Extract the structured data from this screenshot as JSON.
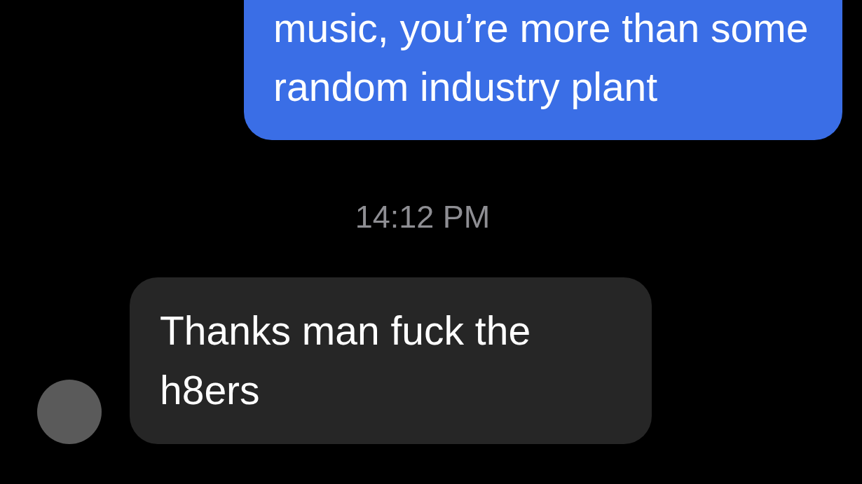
{
  "messages": [
    {
      "kind": "sent",
      "text": "music, you’re more than some random industry plant"
    },
    {
      "kind": "timestamp",
      "text": "14:12 PM"
    },
    {
      "kind": "received",
      "text": "Thanks man fuck the h8ers"
    }
  ]
}
